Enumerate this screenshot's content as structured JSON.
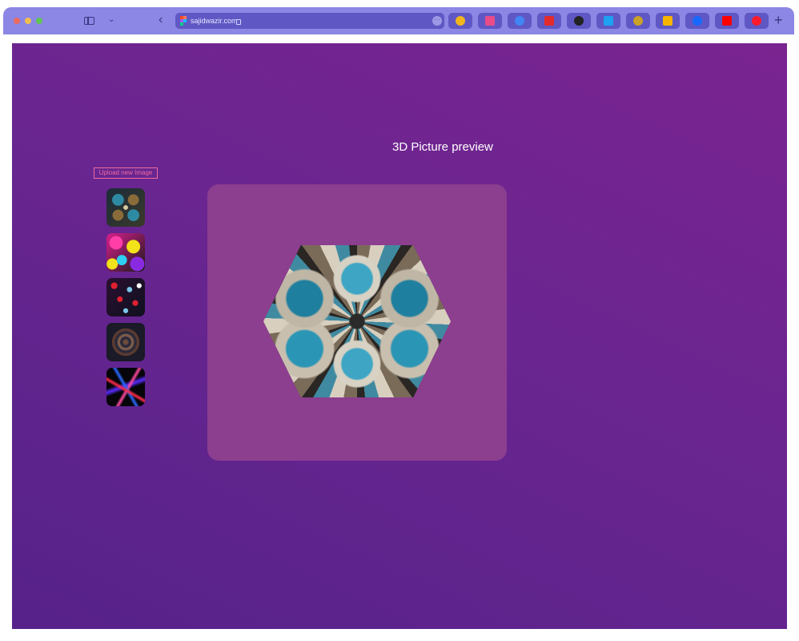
{
  "browser": {
    "url": "sajidwazir.com",
    "new_tab_label": "+",
    "bookmarks": [
      {
        "name": "jira-icon",
        "color": "#f2b61c"
      },
      {
        "name": "dribbble-icon",
        "color": "#ea4c89"
      },
      {
        "name": "google-icon",
        "color": "#4285f4"
      },
      {
        "name": "adobe-icon",
        "color": "#e32b2b"
      },
      {
        "name": "adidas-icon",
        "color": "#222222"
      },
      {
        "name": "twitter-icon",
        "color": "#1da1f2"
      },
      {
        "name": "crown-icon",
        "color": "#c9a227"
      },
      {
        "name": "sketch-icon",
        "color": "#f7b500"
      },
      {
        "name": "behance-icon",
        "color": "#1769ff"
      },
      {
        "name": "youtube-icon",
        "color": "#ff0000"
      },
      {
        "name": "opera-icon",
        "color": "#ff1b2d"
      }
    ]
  },
  "page": {
    "title": "3D Picture preview",
    "upload_label": "Upload new Image",
    "thumbnails": [
      {
        "name": "fractal-teal-flower"
      },
      {
        "name": "colorful-abstract"
      },
      {
        "name": "red-blue-pattern"
      },
      {
        "name": "spiral-fractal"
      },
      {
        "name": "neon-light-streaks"
      }
    ],
    "preview_shape": "hexagon",
    "colors": {
      "accent": "#f06aa0",
      "preview_panel": "#8c3e8f",
      "background_start": "#56228a",
      "background_end": "#7a2490"
    }
  }
}
